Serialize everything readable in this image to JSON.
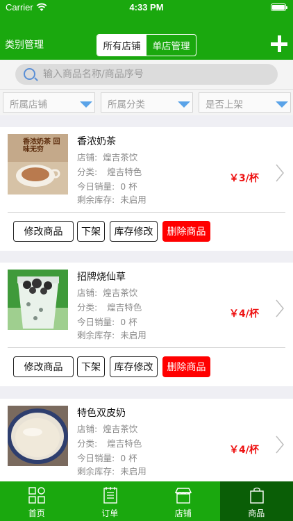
{
  "status": {
    "carrier": "Carrier",
    "time": "4:33 PM"
  },
  "header": {
    "category_mgmt": "类别管理",
    "segments": [
      "所有店铺",
      "单店管理"
    ]
  },
  "search": {
    "placeholder": "输入商品名称/商品序号"
  },
  "filters": [
    "所属店铺",
    "所属分类",
    "是否上架"
  ],
  "labels": {
    "store": "店铺:",
    "category": "分类:",
    "today_sales": "今日销量:",
    "stock": "剩余库存:"
  },
  "products": [
    {
      "name": "香浓奶茶",
      "store": "煌吉茶饮",
      "category": "煌吉特色",
      "today_sales": "0 杯",
      "stock": "未启用",
      "price": "￥3/杯",
      "image_text": "香浓奶茶 回味无穷"
    },
    {
      "name": "招牌烧仙草",
      "store": "煌吉茶饮",
      "category": "煌吉特色",
      "today_sales": "0 杯",
      "stock": "未启用",
      "price": "￥4/杯"
    },
    {
      "name": "特色双皮奶",
      "store": "煌吉茶饮",
      "category": "煌吉特色",
      "today_sales": "0 杯",
      "stock": "未启用",
      "price": "￥4/杯"
    }
  ],
  "actions": {
    "edit": "修改商品",
    "off_shelf": "下架",
    "stock_edit": "库存修改",
    "delete": "删除商品"
  },
  "tabbar": [
    {
      "label": "首页",
      "icon": "grid-icon"
    },
    {
      "label": "订单",
      "icon": "order-list-icon"
    },
    {
      "label": "店铺",
      "icon": "shop-icon"
    },
    {
      "label": "商品",
      "icon": "bag-icon"
    }
  ],
  "colors": {
    "brand_green": "#1aa80e",
    "selected_tab": "#0a5e06",
    "price_red": "#ee1111",
    "delete_red": "#ff0000"
  }
}
